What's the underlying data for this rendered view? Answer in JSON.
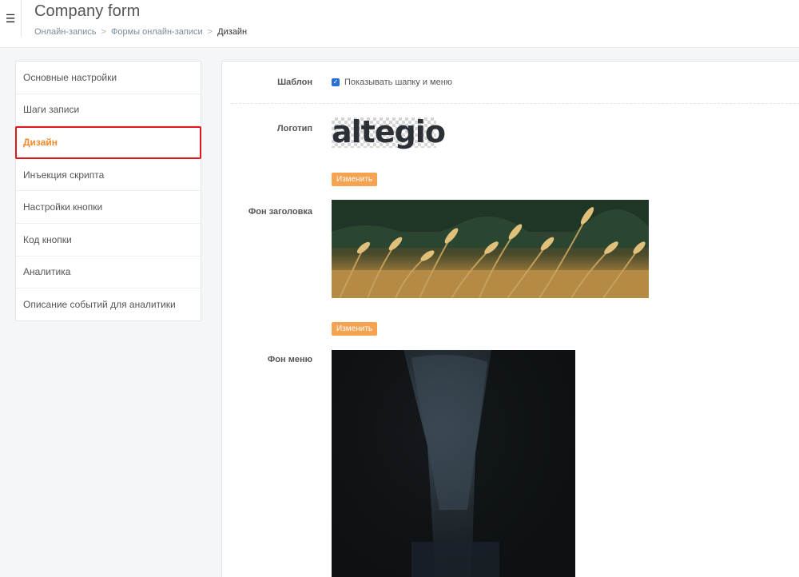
{
  "header": {
    "title": "Company form",
    "breadcrumb": [
      "Онлайн-запись",
      "Формы онлайн-записи",
      "Дизайн"
    ],
    "breadcrumb_separator": ">"
  },
  "sidebar": {
    "items": [
      {
        "label": "Основные настройки",
        "active": false
      },
      {
        "label": "Шаги записи",
        "active": false
      },
      {
        "label": "Дизайн",
        "active": true
      },
      {
        "label": "Инъекция скрипта",
        "active": false
      },
      {
        "label": "Настройки кнопки",
        "active": false
      },
      {
        "label": "Код кнопки",
        "active": false
      },
      {
        "label": "Аналитика",
        "active": false
      },
      {
        "label": "Описание событий для аналитики",
        "active": false
      }
    ]
  },
  "form": {
    "template_label": "Шаблон",
    "template_checkbox_label": "Показывать шапку и меню",
    "template_checked": true,
    "logo_label": "Логотип",
    "logo_text": "altegio",
    "change_button_label": "Изменить",
    "header_bg_label": "Фон заголовка",
    "menu_bg_label": "Фон меню"
  },
  "colors": {
    "accent": "#f08a2c",
    "button": "#f5a251",
    "active_outline": "#e3161c",
    "checkbox": "#2a6fd6"
  }
}
